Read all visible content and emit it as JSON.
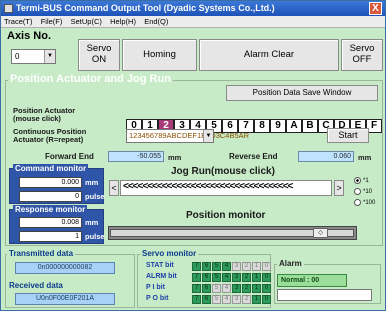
{
  "window": {
    "title": "Termi-BUS Command Output Tool (Dyadic Systems Co.,Ltd.)",
    "close": "X"
  },
  "menu": [
    "Trace(T)",
    "File(F)",
    "SetUp(C)",
    "Help(H)",
    "End(Q)"
  ],
  "axis": {
    "label": "Axis No.",
    "value": "0"
  },
  "buttons": {
    "servo_on": "Servo\nON",
    "homing": "Homing",
    "alarm_clear": "Alarm Clear",
    "servo_off": "Servo\nOFF",
    "save": "Position Data Save Window",
    "start": "Start"
  },
  "section": {
    "title": "Position Actuator and Jog Run"
  },
  "position": {
    "label": "Position Actuator\n(mouse click)",
    "cells": [
      "0",
      "1",
      "2",
      "3",
      "4",
      "5",
      "6",
      "7",
      "8",
      "9",
      "A",
      "B",
      "C",
      "D",
      "E",
      "F"
    ],
    "selected": 2
  },
  "continuous": {
    "label": "Continuous Position\nActuator (R=repeat)",
    "value": "123456789ABCDEF1E2D3C4B5AR"
  },
  "ends": {
    "forward_label": "Forward End",
    "forward_value": "-50.055",
    "forward_unit": "mm",
    "reverse_label": "Reverse End",
    "reverse_value": "0.060",
    "reverse_unit": "mm"
  },
  "command_monitor": {
    "title": "Command monitor",
    "mm": "0.000",
    "pulse": "0",
    "mm_unit": "mm",
    "pulse_unit": "pulse"
  },
  "response_monitor": {
    "title": "Response monitor",
    "mm": "0.008",
    "pulse": "1",
    "mm_unit": "mm",
    "pulse_unit": "pulse"
  },
  "jog": {
    "title": "Jog Run(mouse click)",
    "arrows": "<<<<<<<<<<<<<<<<<<<<<<<<<<<<<<<<<<<",
    "left": "<",
    "right": ">"
  },
  "speed": {
    "options": [
      "*1",
      "*10",
      "*100"
    ],
    "selected": 0
  },
  "position_monitor": {
    "title": "Position monitor"
  },
  "transmitted": {
    "title": "Transmitted data",
    "value": "0n000000000082"
  },
  "received": {
    "title": "Received data",
    "value": "U0n0F00E0F201A"
  },
  "servo_monitor": {
    "title": "Servo monitor",
    "rows": [
      {
        "label": "STAT bit",
        "bits": [
          "7",
          "6",
          "5",
          "4",
          "3",
          "2",
          "1",
          "0"
        ],
        "on": [
          1,
          1,
          1,
          1,
          0,
          0,
          0,
          0
        ]
      },
      {
        "label": "ALRM bit",
        "bits": [
          "7",
          "6",
          "5",
          "4",
          "3",
          "2",
          "1",
          "0"
        ],
        "on": [
          1,
          1,
          1,
          1,
          1,
          1,
          1,
          1
        ]
      },
      {
        "label": "P I  bit",
        "bits": [
          "7",
          "6",
          "5",
          "4",
          "3",
          "2",
          "1",
          "0"
        ],
        "on": [
          1,
          1,
          0,
          0,
          1,
          1,
          1,
          1
        ]
      },
      {
        "label": "P O  bit",
        "bits": [
          "7",
          "6",
          "5",
          "4",
          "3",
          "2",
          "1",
          "0"
        ],
        "on": [
          1,
          1,
          0,
          0,
          0,
          0,
          1,
          1
        ]
      }
    ]
  },
  "alarm": {
    "title": "Alarm",
    "status": "Normal : 00"
  }
}
